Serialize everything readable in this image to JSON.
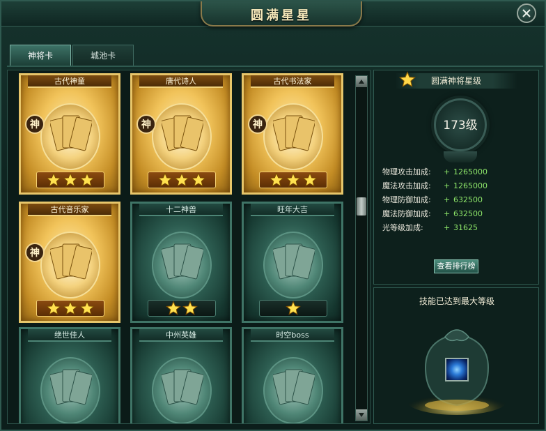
{
  "window": {
    "title": "圆满星星"
  },
  "tabs": [
    {
      "label": "神将卡",
      "active": true
    },
    {
      "label": "城池卡",
      "active": false
    }
  ],
  "cards": [
    {
      "name": "古代神童",
      "style": "gold",
      "badge": "神",
      "stars": 3
    },
    {
      "name": "唐代诗人",
      "style": "gold",
      "badge": "神",
      "stars": 3
    },
    {
      "name": "古代书法家",
      "style": "gold",
      "badge": "神",
      "stars": 3
    },
    {
      "name": "古代音乐家",
      "style": "gold",
      "badge": "神",
      "stars": 3
    },
    {
      "name": "十二神兽",
      "style": "jade",
      "badge": "",
      "stars": 2
    },
    {
      "name": "旺年大吉",
      "style": "jade",
      "badge": "",
      "stars": 1
    },
    {
      "name": "绝世佳人",
      "style": "jade",
      "badge": "",
      "stars": 0
    },
    {
      "name": "中州英雄",
      "style": "jade",
      "badge": "",
      "stars": 0
    },
    {
      "name": "时空boss",
      "style": "jade",
      "badge": "",
      "stars": 0
    }
  ],
  "star_panel": {
    "title": "圆满神将星级",
    "level": "173级",
    "stats": [
      {
        "label": "物理攻击加成:",
        "plus": "+",
        "value": "1265000"
      },
      {
        "label": "魔法攻击加成:",
        "plus": "+",
        "value": "1265000"
      },
      {
        "label": "物理防御加成:",
        "plus": "+",
        "value": "632500"
      },
      {
        "label": "魔法防御加成:",
        "plus": "+",
        "value": "632500"
      },
      {
        "label": "光等级加成:",
        "plus": "+",
        "value": "31625"
      }
    ],
    "rank_button": "查看排行榜"
  },
  "skill_panel": {
    "title": "技能已达到最大等级"
  },
  "colors": {
    "gold_card": "#f1c35a",
    "jade_card": "#2c5c50",
    "stat_value": "#8fe86a",
    "title_text": "#f3e6b8"
  },
  "icons": {
    "close": "close-icon",
    "star": "star-icon",
    "skill": "skill-icon"
  },
  "scroll": {
    "position_fraction": 0.36
  }
}
